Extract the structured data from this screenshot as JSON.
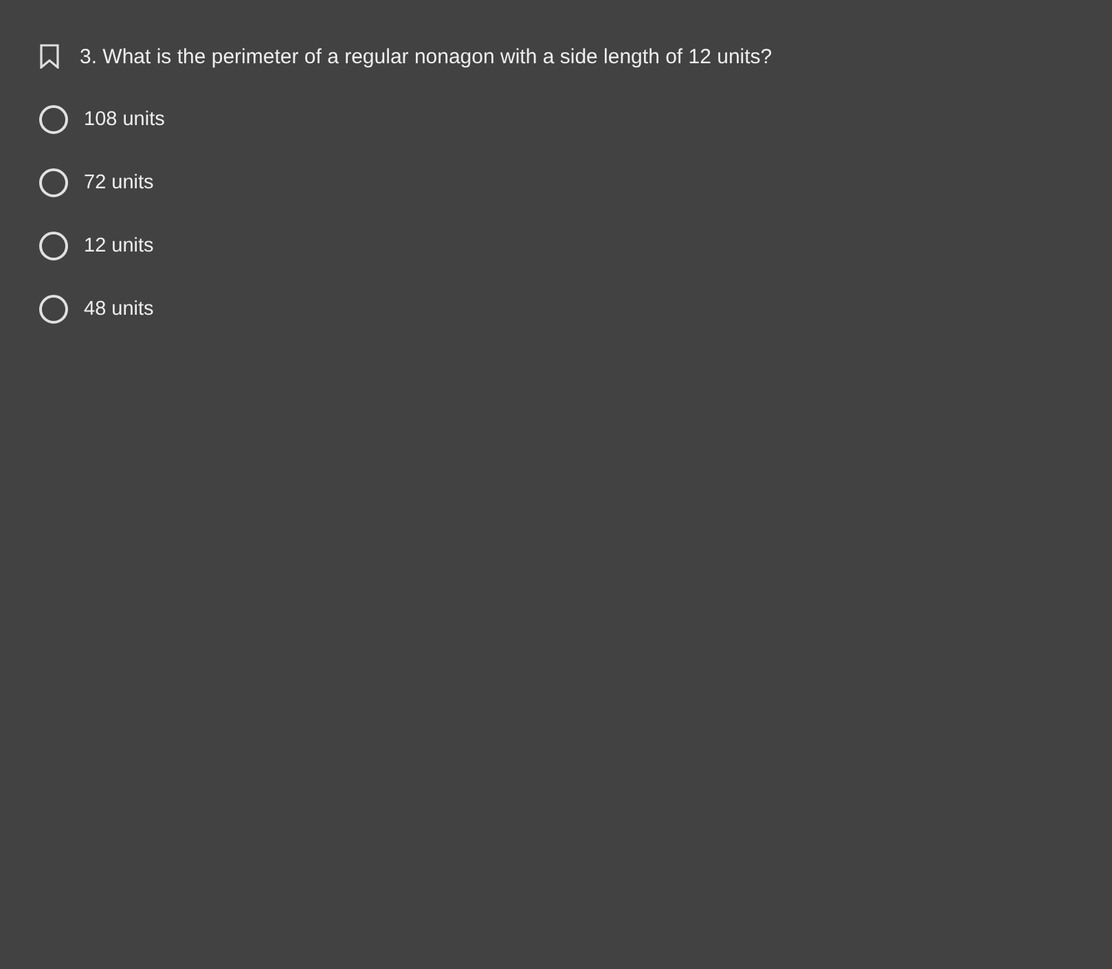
{
  "question": {
    "text": "3. What is the perimeter of a regular nonagon with a side length of 12 units?",
    "bookmarked": false
  },
  "options": [
    {
      "label": "108 units",
      "selected": false
    },
    {
      "label": "72 units",
      "selected": false
    },
    {
      "label": "12 units",
      "selected": false
    },
    {
      "label": "48 units",
      "selected": false
    }
  ]
}
